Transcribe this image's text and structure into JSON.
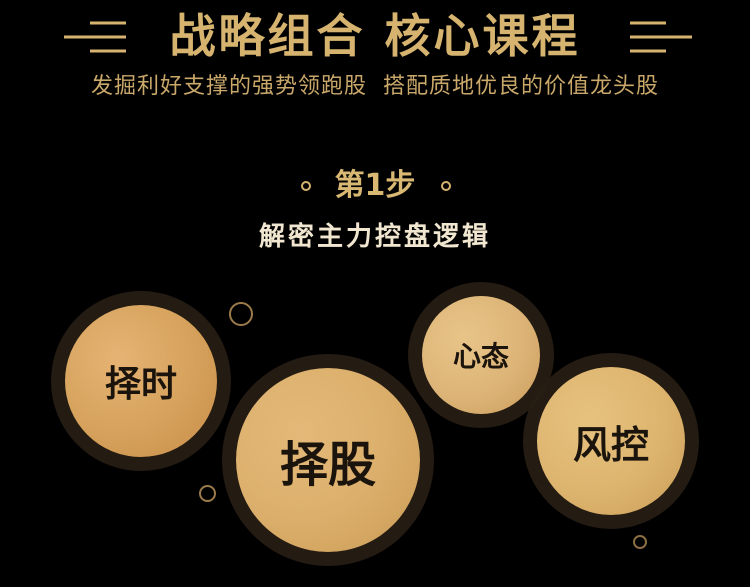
{
  "header": {
    "title": "战略组合 核心课程",
    "subtitle_part1": "发掘利好支撑的强势领跑股",
    "subtitle_part2": "搭配质地优良的价值龙头股"
  },
  "step": {
    "label": "第1步",
    "description": "解密主力控盘逻辑"
  },
  "bubbles": {
    "zeshi": "择时",
    "zegu": "择股",
    "xintai": "心态",
    "fengkong": "风控"
  },
  "colors": {
    "background": "#000000",
    "gold_title": "#d6b46f",
    "gold_subtitle": "#c9a86a",
    "bubble_gold": "#d8a560",
    "text_light": "#f1e6cf",
    "bubble_text": "#1b140c"
  }
}
